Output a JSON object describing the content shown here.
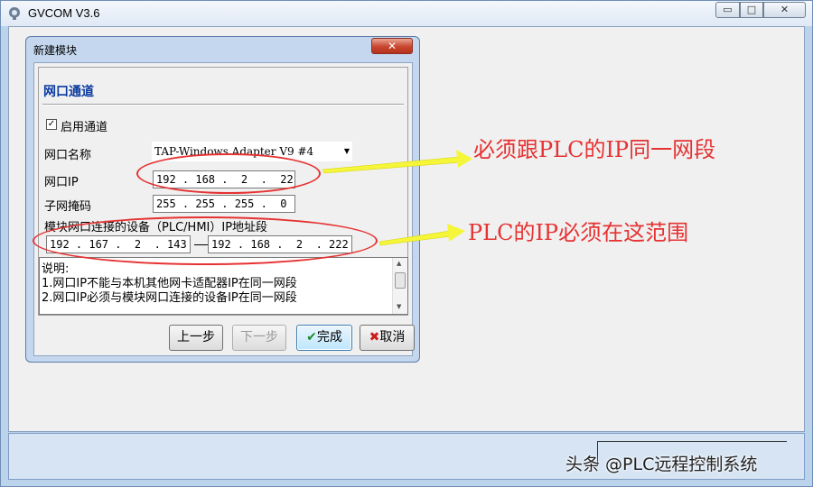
{
  "app": {
    "title": "GVCOM  V3.6",
    "min_glyph": "▭",
    "max_glyph": "□",
    "close_glyph": "✕"
  },
  "dialog": {
    "title": "新建模块",
    "close_glyph": "✕",
    "section_title": "网口通道",
    "enable_channel": {
      "label": "启用通道",
      "checked": true
    },
    "nic_name": {
      "label": "网口名称",
      "value": "TAP-Windows Adapter V9 #4"
    },
    "nic_ip": {
      "label": "网口IP",
      "value": "192 . 168 .  2  .  22"
    },
    "subnet_mask": {
      "label": "子网掩码",
      "value": "255 . 255 . 255 .  0"
    },
    "device_range": {
      "label": "模块网口连接的设备（PLC/HMI）IP地址段",
      "start": "192 . 167 .  2  . 143",
      "end": "192 . 168 .  2  . 222"
    },
    "notes": {
      "heading": "说明:",
      "line1": "1.网口IP不能与本机其他网卡适配器IP在同一网段",
      "line2": "2.网口IP必须与模块网口连接的设备IP在同一网段"
    },
    "buttons": {
      "prev": "上一步",
      "next": "下一步",
      "finish": "完成",
      "cancel": "取消"
    }
  },
  "annotations": {
    "note1": "必须跟PLC的IP同一网段",
    "note2": "PLC的IP必须在这范围",
    "color": "#e63232"
  },
  "watermark": "头条 @PLC远程控制系统",
  "colors": {
    "accent_blue": "#0a3aa0",
    "titlebar_frame": "#bcd3ec",
    "close_red": "#c8452e",
    "arrow_yellow": "#f5f53a"
  }
}
